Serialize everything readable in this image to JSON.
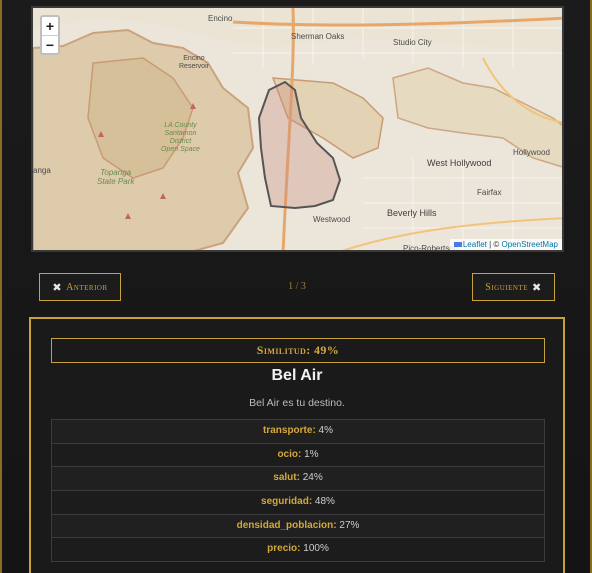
{
  "map": {
    "zoom_in": "+",
    "zoom_out": "−",
    "attribution_leaflet": "Leaflet",
    "attribution_sep": " | © ",
    "attribution_osm": "OpenStreetMap",
    "places": {
      "encino": "Encino",
      "sherman_oaks": "Sherman Oaks",
      "studio_city": "Studio City",
      "encino_reservoir": "Encino\nReservoir",
      "la_county": "LA County\nSantamon\nDistrict\nOpen Space",
      "topanga": "Topanga\nState Park",
      "west_hollywood": "West Hollywood",
      "hollywood": "Hollywood",
      "fairfax": "Fairfax",
      "westwood": "Westwood",
      "beverly_hills": "Beverly Hills",
      "pico_robertson": "Pico-Robertson",
      "ganga": "anga"
    }
  },
  "pager": {
    "prev_label": "Anterior",
    "next_label": "Siguiente",
    "count": "1 / 3",
    "icon": "✖"
  },
  "card": {
    "similarity": "Similitud: 49%",
    "title": "Bel Air",
    "description": "Bel Air es tu destino.",
    "stats": [
      {
        "key": "transporte:",
        "value": " 4%"
      },
      {
        "key": "ocio:",
        "value": " 1%"
      },
      {
        "key": "salut:",
        "value": " 24%"
      },
      {
        "key": "seguridad:",
        "value": " 48%"
      },
      {
        "key": "densidad_poblacion:",
        "value": " 27%"
      },
      {
        "key": "precio:",
        "value": " 100%"
      }
    ]
  }
}
